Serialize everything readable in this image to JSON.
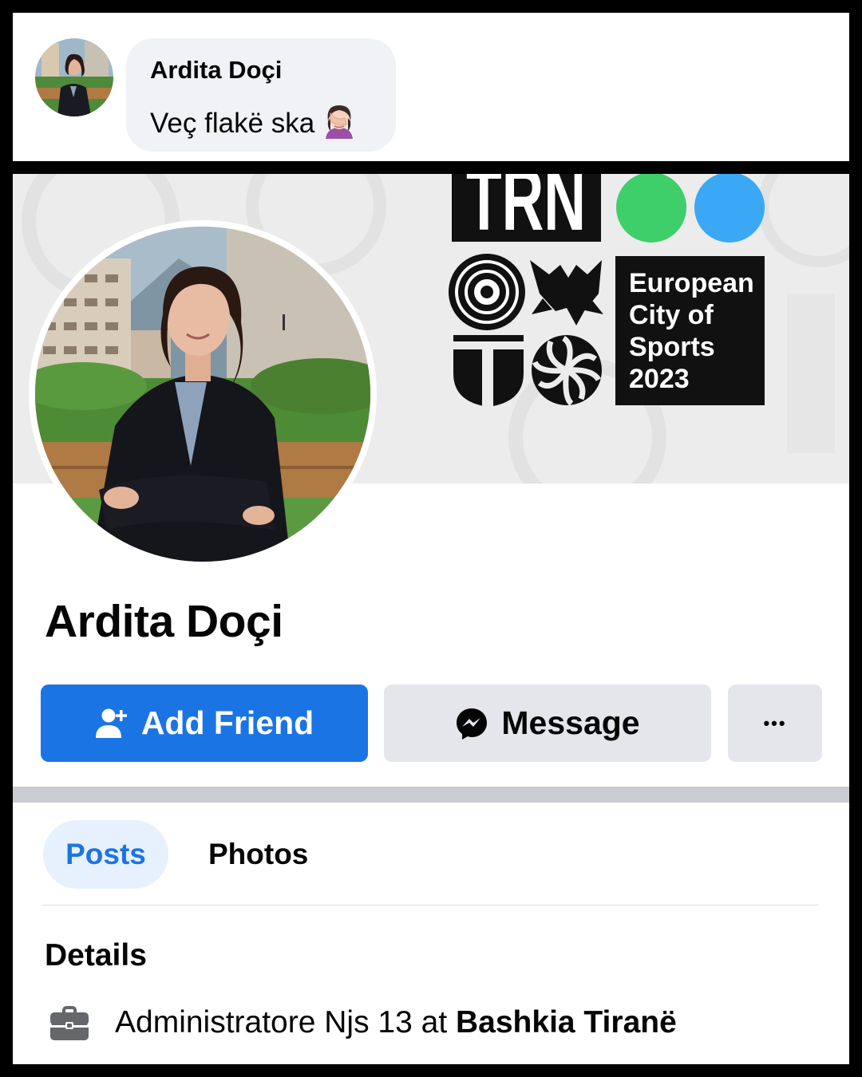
{
  "comment": {
    "author": "Ardita Doçi",
    "text": "Veç flakë ska",
    "emoji": "woman-facepalming-emoji"
  },
  "cover": {
    "logo_partial": "TRN",
    "badge_lines": [
      "European",
      "City of",
      "Sports",
      "2023"
    ],
    "dot_colors": [
      "#3fcf6a",
      "#3aa8f5"
    ]
  },
  "profile": {
    "name": "Ardita Doçi"
  },
  "actions": {
    "add_friend_label": "Add Friend",
    "message_label": "Message",
    "more_label": "•••"
  },
  "tabs": [
    {
      "label": "Posts",
      "active": true
    },
    {
      "label": "Photos",
      "active": false
    }
  ],
  "details": {
    "heading": "Details",
    "work_role": "Administratore Njs 13",
    "work_connector": " at ",
    "work_place": "Bashkia Tiranë"
  },
  "colors": {
    "accent": "#1b74e4",
    "secondary_button": "#e4e6eb"
  }
}
